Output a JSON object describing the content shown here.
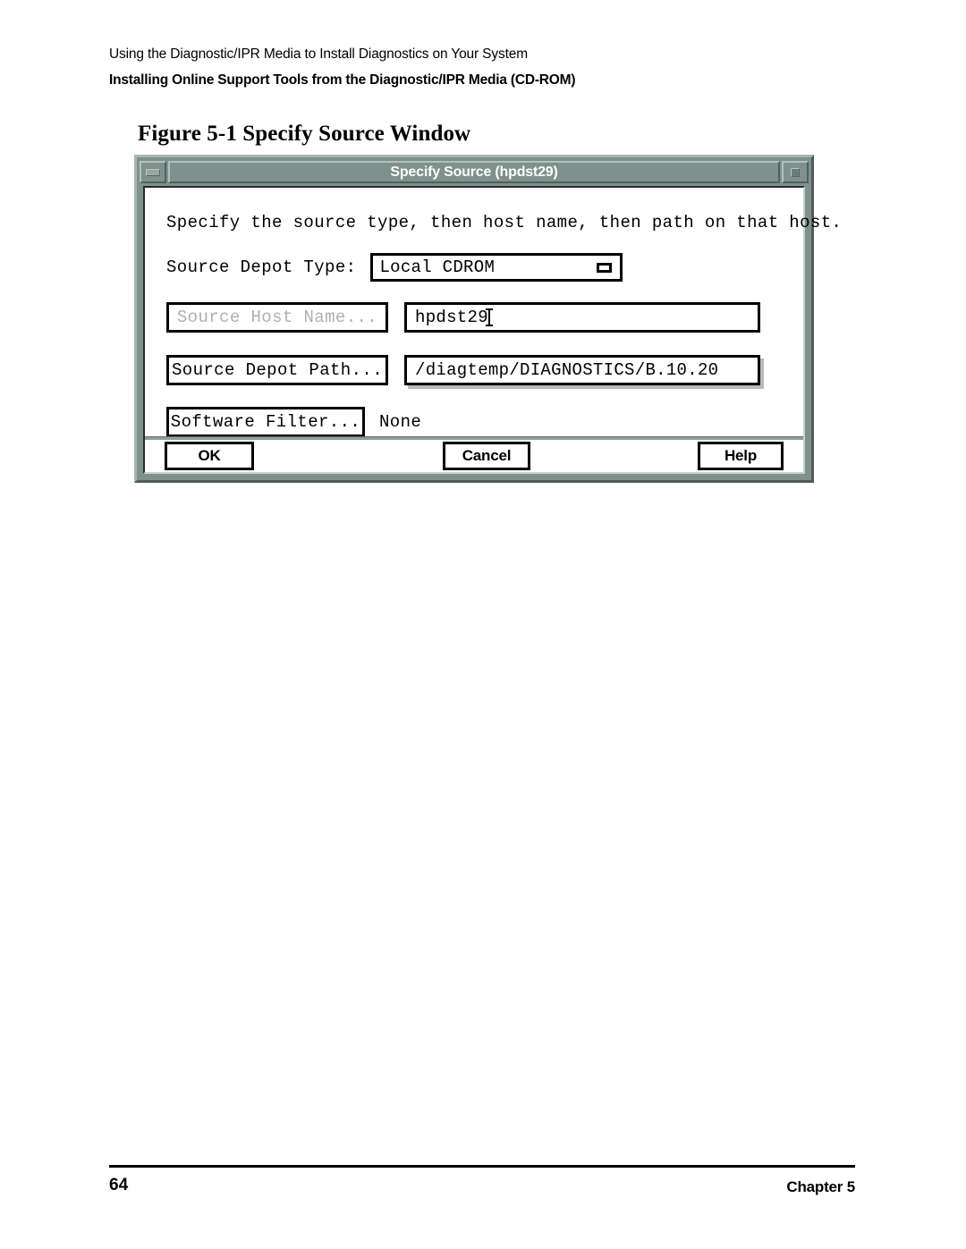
{
  "page": {
    "running_head_line1": "Using the Diagnostic/IPR Media to Install Diagnostics on Your System",
    "running_head_line2": "Installing Online Support Tools from the Diagnostic/IPR Media (CD-ROM)",
    "figure_caption": "Figure 5-1 Specify Source Window",
    "page_number": "64",
    "chapter_label": "Chapter 5"
  },
  "dialog": {
    "title": "Specify Source (hpdst29)",
    "minimize_icon": "minimize-icon",
    "maximize_icon": "maximize-icon",
    "instruction": "Specify the source type, then host name, then path on that host.",
    "depot_type": {
      "label": "Source Depot Type:",
      "value": "Local CDROM",
      "indicator_icon": "option-menu-indicator-icon"
    },
    "host_name": {
      "button_label": "Source Host Name...",
      "button_enabled": false,
      "value": "hpdst29"
    },
    "depot_path": {
      "button_label": "Source Depot Path...",
      "button_enabled": true,
      "value": "/diagtemp/DIAGNOSTICS/B.10.20"
    },
    "software_filter": {
      "button_label": "Software Filter...",
      "value": "None"
    },
    "actions": {
      "ok": "OK",
      "cancel": "Cancel",
      "help": "Help"
    },
    "colors": {
      "titlebar_background": "#7f918c",
      "titlebar_text": "#ffffff",
      "client_background": "#ffffff",
      "frame_light": "#a7b5b1",
      "frame_dark": "#4f5c59"
    }
  }
}
